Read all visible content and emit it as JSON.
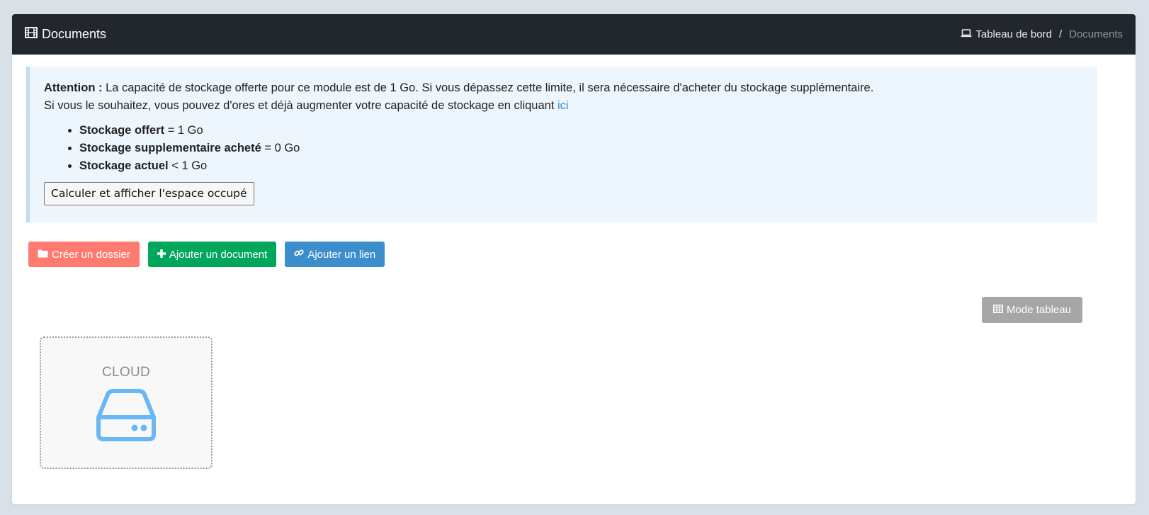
{
  "header": {
    "title": "Documents",
    "breadcrumb": {
      "home": "Tableau de bord",
      "separator": "/",
      "current": "Documents"
    }
  },
  "alert": {
    "attention_label": "Attention :",
    "line1": " La capacité de stockage offerte pour ce module est de 1 Go. Si vous dépassez cette limite, il sera nécessaire d'acheter du stockage supplémentaire.",
    "line2": "Si vous le souhaitez, vous pouvez d'ores et déjà augmenter votre capacité de stockage en cliquant ",
    "link": "ici",
    "items": [
      {
        "label": "Stockage offert",
        "value": " = 1 Go"
      },
      {
        "label": "Stockage supplementaire acheté",
        "value": " = 0 Go"
      },
      {
        "label": "Stockage actuel",
        "value": " < 1 Go"
      }
    ],
    "calc_button": "Calculer et afficher l'espace occupé"
  },
  "actions": {
    "create_folder": "Créer un dossier",
    "add_document": "Ajouter un document",
    "add_link": "Ajouter un lien"
  },
  "view": {
    "mode_button": "Mode tableau"
  },
  "folders": [
    {
      "label": "CLOUD",
      "icon": "hard-drive-icon"
    }
  ],
  "colors": {
    "header_bg": "#22272e",
    "create_folder": "#ff7b72",
    "add_document": "#00a65a",
    "add_link": "#3c8dcc",
    "mode_button": "#a6a6a6",
    "drive_icon": "#6ab7f5"
  }
}
